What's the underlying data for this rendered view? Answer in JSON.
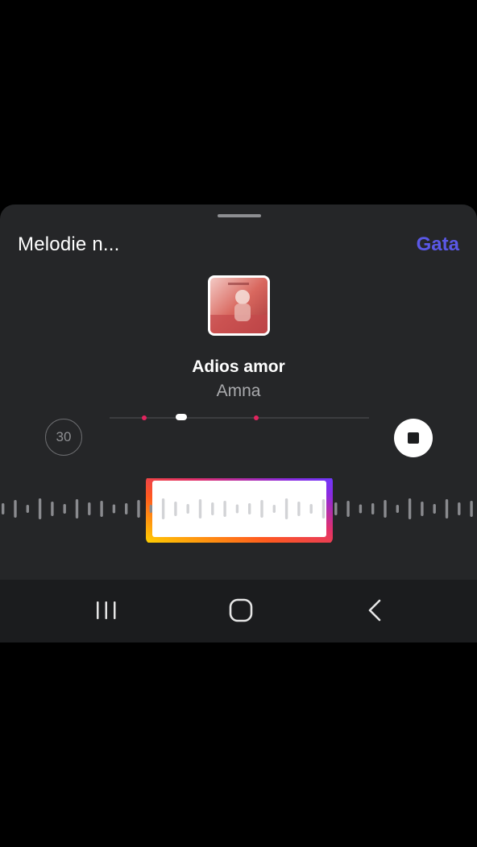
{
  "header": {
    "title": "Melodie n...",
    "done_label": "Gata"
  },
  "track": {
    "title": "Adios amor",
    "artist": "Amna",
    "cover_text": "ADIOS AMOR",
    "duration_label": "30"
  },
  "colors": {
    "accent": "#5a58e6",
    "marker": "#e0245e",
    "sheet_background": "#252628",
    "navbar_background": "#1b1c1e",
    "gradient": [
      "#ffd400",
      "#ff5a1f",
      "#e1306c",
      "#8a2be2",
      "#6a3bff"
    ]
  },
  "icons": {
    "stop": "stop-icon",
    "recents": "recents-icon",
    "home": "home-icon",
    "back": "back-icon"
  }
}
